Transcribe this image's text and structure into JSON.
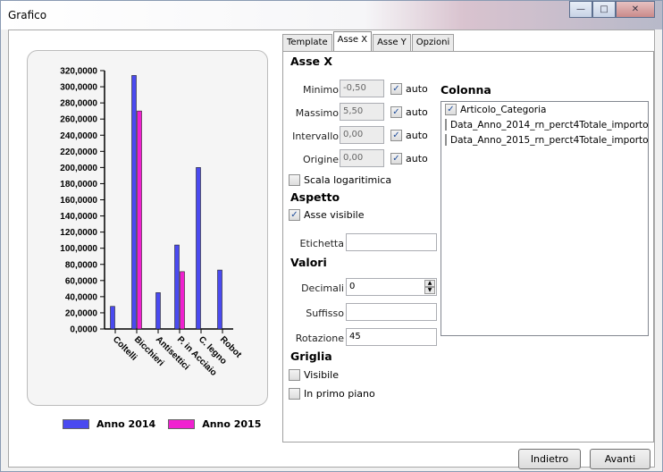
{
  "window": {
    "title": "Grafico"
  },
  "chart_data": {
    "type": "bar",
    "categories": [
      "Coltelli",
      "Bicchieri",
      "Antisettici",
      "P. in Acciaio",
      "C. legno",
      "Robot"
    ],
    "series": [
      {
        "name": "Anno 2014",
        "color": "#4a4af0",
        "values": [
          28000,
          314000,
          null,
          104000,
          200000,
          73000
        ]
      },
      {
        "name": "Anno 2015",
        "color": "#f020d0",
        "values": [
          null,
          270000,
          null,
          71000,
          null,
          null
        ]
      }
    ],
    "single_bar_values": [
      null,
      null,
      45000,
      null,
      null,
      null
    ],
    "yticks": [
      "320,0000",
      "300,0000",
      "280,0000",
      "260,0000",
      "240,0000",
      "220,0000",
      "200,0000",
      "180,0000",
      "160,0000",
      "140,0000",
      "120,0000",
      "100,0000",
      "80,0000",
      "60,0000",
      "40,0000",
      "20,0000",
      "0,0000"
    ],
    "ylim": [
      0,
      320000
    ]
  },
  "legend": [
    {
      "label": "Anno 2014",
      "color": "#4a4af0"
    },
    {
      "label": "Anno 2015",
      "color": "#f020d0"
    }
  ],
  "tabs": [
    "Template",
    "Asse X",
    "Asse Y",
    "Opzioni"
  ],
  "asse": {
    "heading": "Asse X",
    "minimo": {
      "label": "Minimo",
      "value": "-0,50",
      "auto": "auto"
    },
    "massimo": {
      "label": "Massimo",
      "value": "5,50",
      "auto": "auto"
    },
    "intervallo": {
      "label": "Intervallo",
      "value": "0,00",
      "auto": "auto"
    },
    "origine": {
      "label": "Origine",
      "value": "0,00",
      "auto": "auto"
    },
    "scala": "Scala logaritimica"
  },
  "aspetto": {
    "heading": "Aspetto",
    "visibile": "Asse visibile",
    "etichetta_label": "Etichetta",
    "etichetta_value": ""
  },
  "valori": {
    "heading": "Valori",
    "decimali_label": "Decimali",
    "decimali_value": "0",
    "suffisso_label": "Suffisso",
    "suffisso_value": "",
    "rotazione_label": "Rotazione",
    "rotazione_value": "45"
  },
  "griglia": {
    "heading": "Griglia",
    "visibile": "Visibile",
    "primo_piano": "In primo piano"
  },
  "colonna": {
    "heading": "Colonna",
    "items": [
      "Articolo_Categoria",
      "Data_Anno_2014_rn_perct4Totale_importo",
      "Data_Anno_2015_rn_perct4Totale_importo"
    ]
  },
  "buttons": {
    "indietro": "Indietro",
    "avanti": "Avanti"
  }
}
